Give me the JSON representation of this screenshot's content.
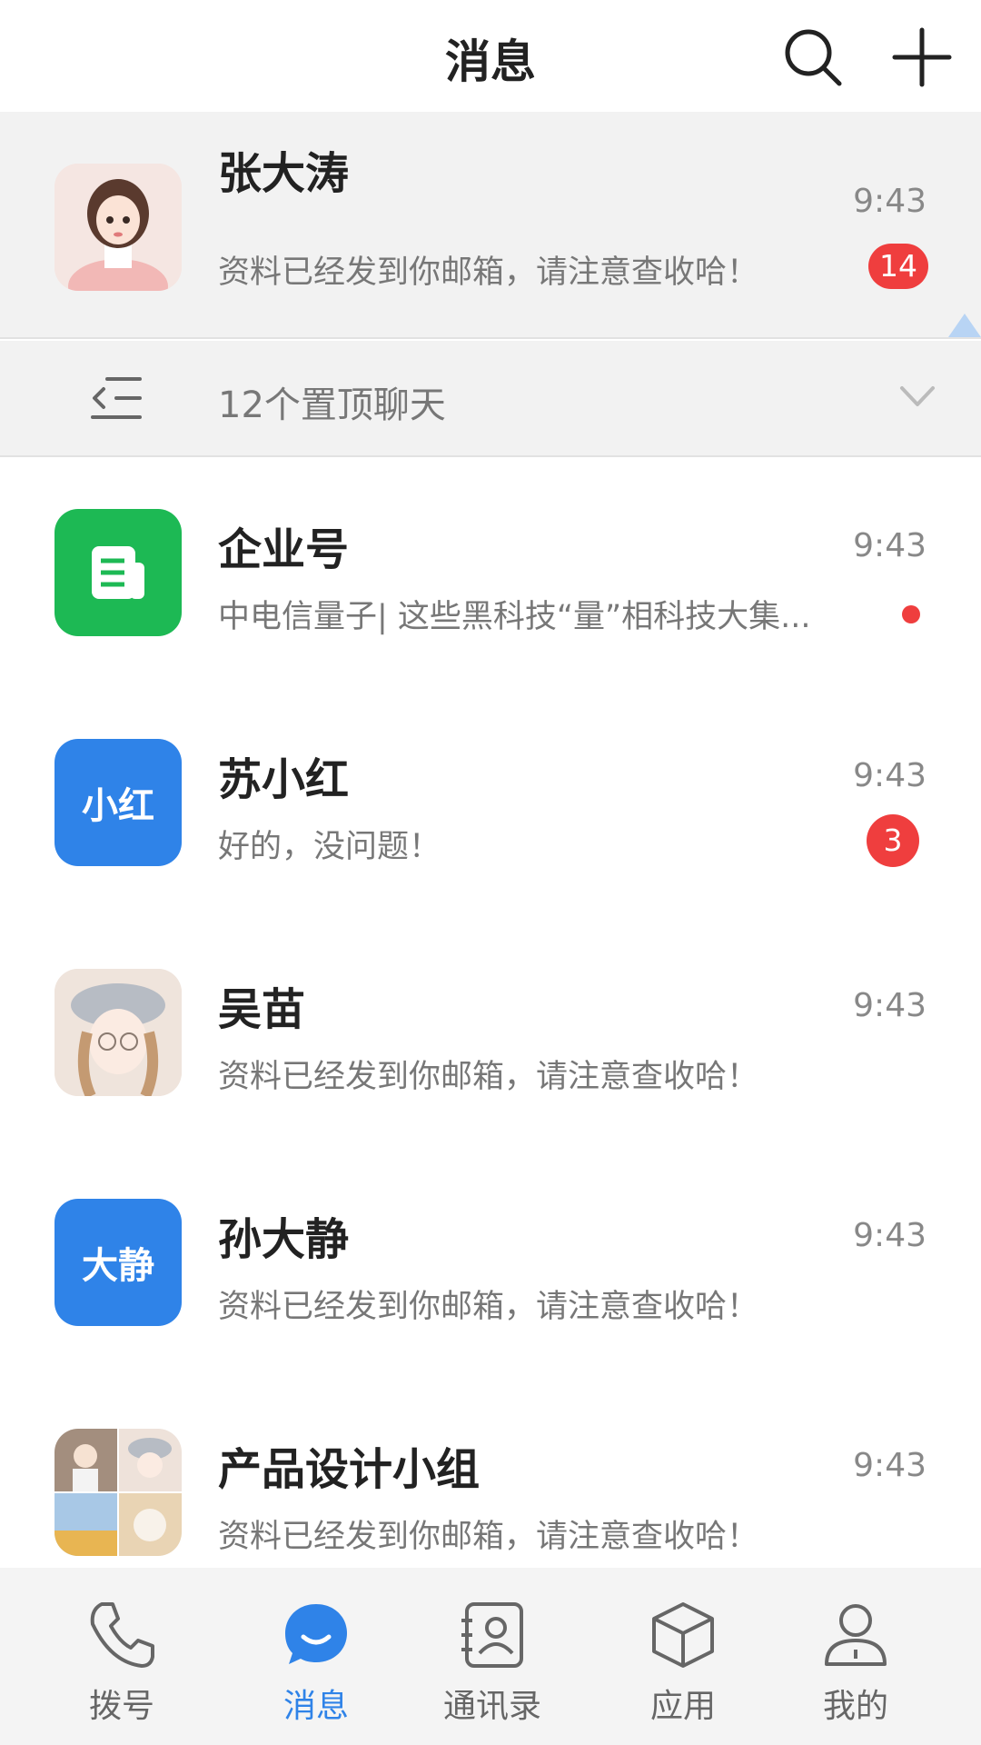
{
  "header": {
    "title": "消息",
    "search_icon": "search-icon",
    "add_icon": "plus-icon"
  },
  "pinned_chat": {
    "name": "张大涛",
    "preview": "资料已经发到你邮箱，请注意查收哈！",
    "time": "9:43",
    "badge": "14"
  },
  "pinned_fold": {
    "label": "12个置顶聊天",
    "icon": "collapse-list-icon",
    "chevron": "chevron-down-icon"
  },
  "chats": [
    {
      "name": "企业号",
      "preview": "中电信量子| 这些黑科技“量”相科技大集...",
      "time": "9:43",
      "avatar_color": "#1db954",
      "unread_dot": true
    },
    {
      "name": "苏小红",
      "avatar_text": "小红",
      "preview": "好的，没问题！",
      "time": "9:43",
      "avatar_color": "#2f83e8",
      "badge": "3"
    },
    {
      "name": "吴苗",
      "preview": "资料已经发到你邮箱，请注意查收哈！",
      "time": "9:43"
    },
    {
      "name": "孙大静",
      "avatar_text": "大静",
      "preview": "资料已经发到你邮箱，请注意查收哈！",
      "time": "9:43",
      "avatar_color": "#2f83e8"
    },
    {
      "name": "产品设计小组",
      "preview": "资料已经发到你邮箱，请注意查收哈！",
      "time": "9:43"
    }
  ],
  "tabs": [
    {
      "label": "拨号",
      "icon": "phone-icon"
    },
    {
      "label": "消息",
      "icon": "chat-bubble-icon",
      "active": true
    },
    {
      "label": "通讯录",
      "icon": "contacts-icon"
    },
    {
      "label": "应用",
      "icon": "cube-icon"
    },
    {
      "label": "我的",
      "icon": "person-icon"
    }
  ],
  "colors": {
    "accent": "#2f83e8",
    "badge": "#ef3e3e",
    "green": "#1db954"
  }
}
